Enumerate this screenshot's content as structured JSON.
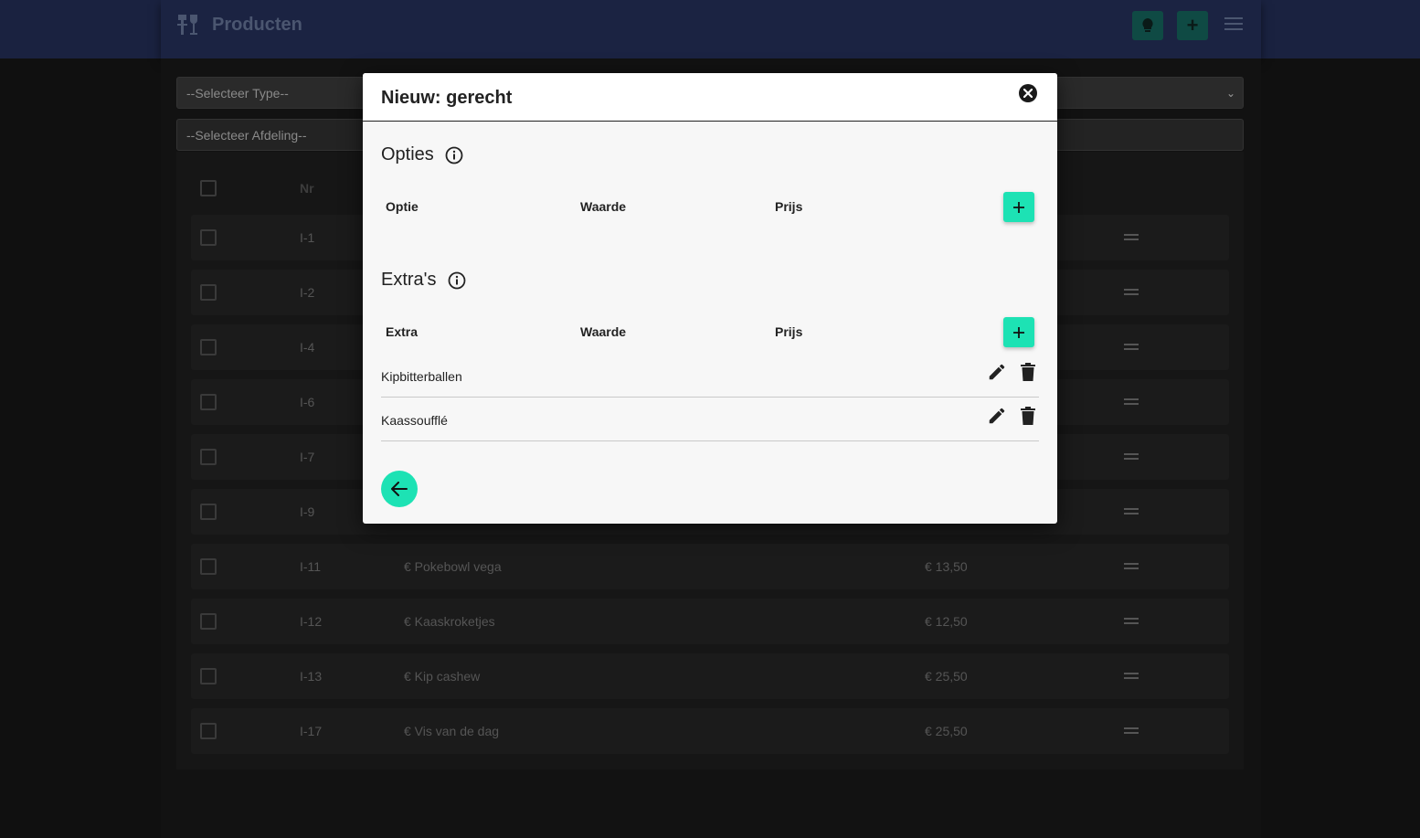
{
  "app": {
    "title": "Producten",
    "filters": {
      "type_placeholder": "--Selecteer Type--",
      "afdeling_placeholder": "--Selecteer Afdeling--"
    }
  },
  "table": {
    "header_nr": "Nr",
    "rows": [
      {
        "nr": "I-1",
        "name": "",
        "price": ""
      },
      {
        "nr": "I-2",
        "name": "",
        "price": ""
      },
      {
        "nr": "I-4",
        "name": "",
        "price": ""
      },
      {
        "nr": "I-6",
        "name": "",
        "price": ""
      },
      {
        "nr": "I-7",
        "name": "",
        "price": ""
      },
      {
        "nr": "I-9",
        "name": "",
        "price": ""
      },
      {
        "nr": "I-11",
        "name": "€ Pokebowl vega",
        "price": "€ 13,50"
      },
      {
        "nr": "I-12",
        "name": "€ Kaaskroketjes",
        "price": "€ 12,50"
      },
      {
        "nr": "I-13",
        "name": "€ Kip cashew",
        "price": "€ 25,50"
      },
      {
        "nr": "I-17",
        "name": "€ Vis van de dag",
        "price": "€ 25,50"
      }
    ]
  },
  "modal": {
    "title": "Nieuw: gerecht",
    "options": {
      "title": "Opties",
      "col_name": "Optie",
      "col_value": "Waarde",
      "col_price": "Prijs",
      "add_label": "+"
    },
    "extras": {
      "title": "Extra's",
      "col_name": "Extra",
      "col_value": "Waarde",
      "col_price": "Prijs",
      "add_label": "+",
      "items": [
        {
          "name": "Kipbitterballen"
        },
        {
          "name": "Kaassoufflé"
        }
      ]
    }
  },
  "colors": {
    "accent": "#1de2b4",
    "topbar": "#1b2342",
    "overlay_bg": "#101010"
  }
}
